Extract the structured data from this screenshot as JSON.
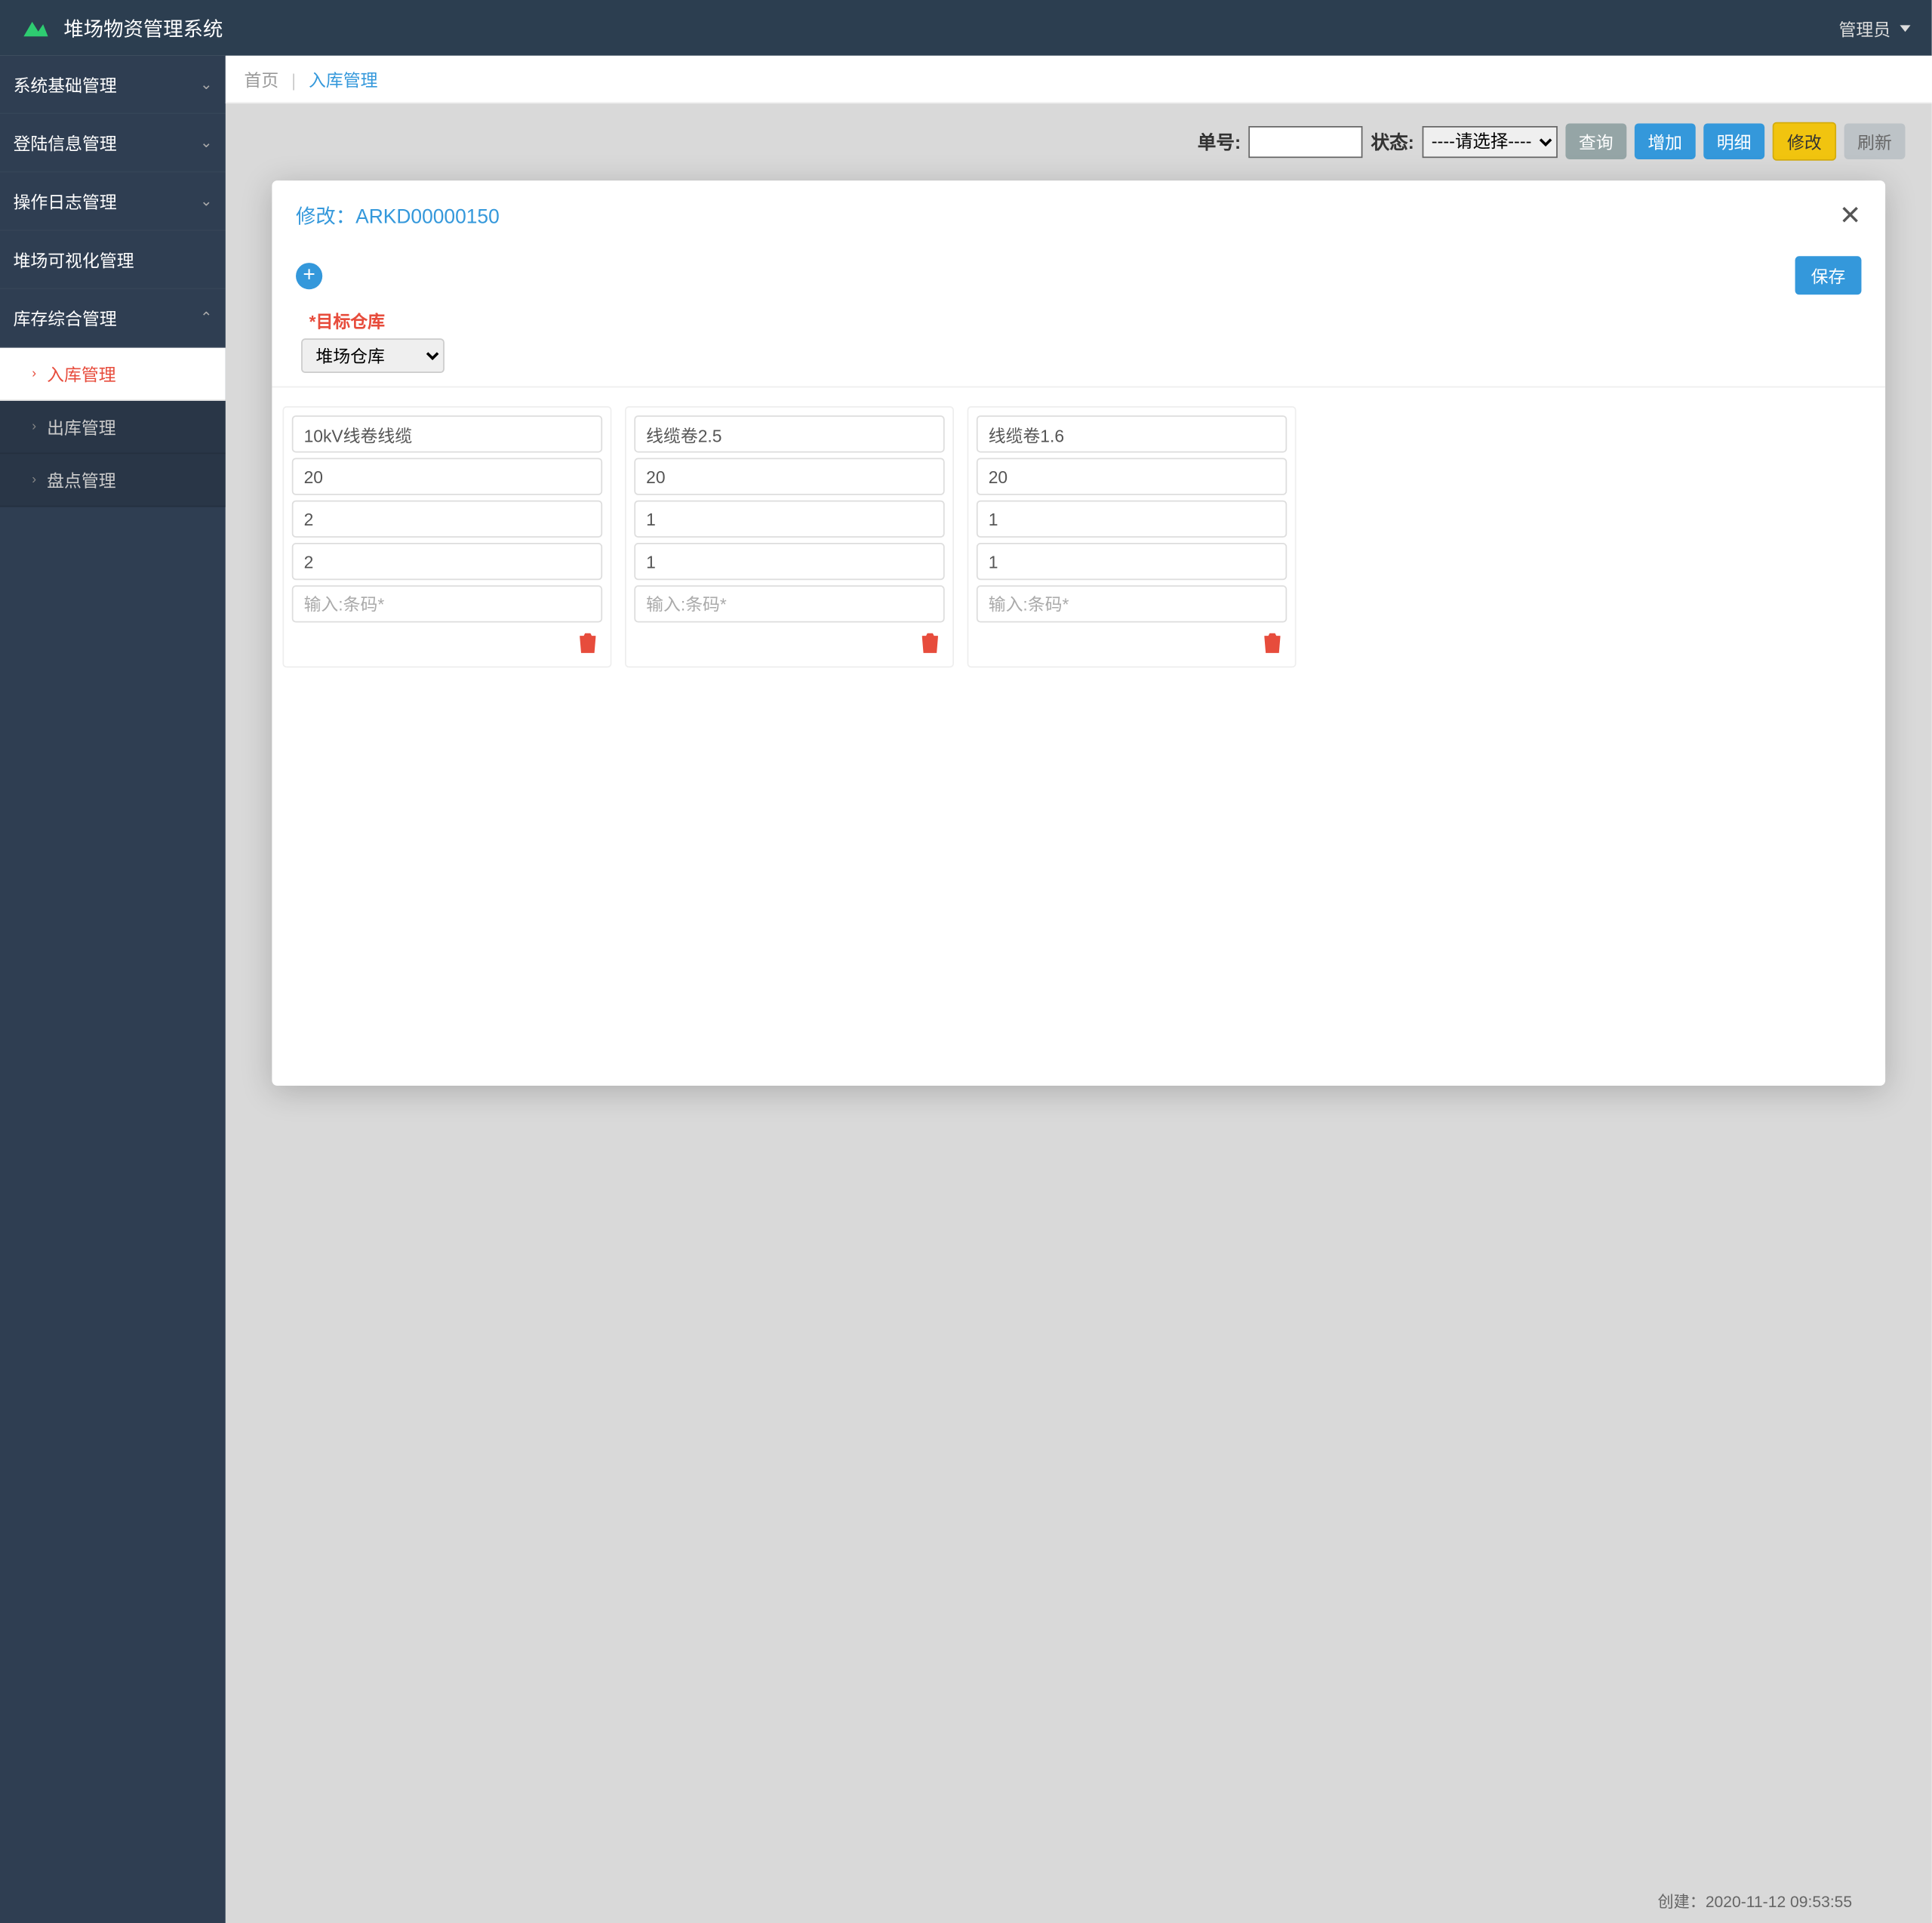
{
  "header": {
    "title": "堆场物资管理系统",
    "user_label": "管理员"
  },
  "sidebar": {
    "groups": [
      {
        "label": "系统基础管理",
        "expanded": false
      },
      {
        "label": "登陆信息管理",
        "expanded": false
      },
      {
        "label": "操作日志管理",
        "expanded": false
      },
      {
        "label": "堆场可视化管理",
        "expanded": false
      },
      {
        "label": "库存综合管理",
        "expanded": true
      }
    ],
    "submenu": [
      {
        "label": "入库管理",
        "active": true
      },
      {
        "label": "出库管理",
        "active": false
      },
      {
        "label": "盘点管理",
        "active": false
      }
    ]
  },
  "breadcrumb": {
    "home": "首页",
    "current": "入库管理"
  },
  "filter": {
    "order_label": "单号:",
    "order_value": "",
    "status_label": "状态:",
    "status_placeholder": "----请选择----",
    "buttons": {
      "search": "查询",
      "add": "增加",
      "detail": "明细",
      "edit": "修改",
      "refresh": "刷新"
    }
  },
  "modal": {
    "title_prefix": "修改：",
    "order_no": "ARKD00000150",
    "save_label": "保存",
    "target_label": "*目标仓库",
    "target_value": "堆场仓库",
    "barcode_placeholder": "输入:条码*",
    "cards": [
      {
        "name": "10kV线卷线缆",
        "v1": "20",
        "v2": "2",
        "v3": "2",
        "barcode": ""
      },
      {
        "name": "线缆卷2.5",
        "v1": "20",
        "v2": "1",
        "v3": "1",
        "barcode": ""
      },
      {
        "name": "线缆卷1.6",
        "v1": "20",
        "v2": "1",
        "v3": "1",
        "barcode": ""
      }
    ]
  },
  "behind": {
    "created_label": "创建：",
    "created_value": "2020-11-12 09:53:55"
  }
}
